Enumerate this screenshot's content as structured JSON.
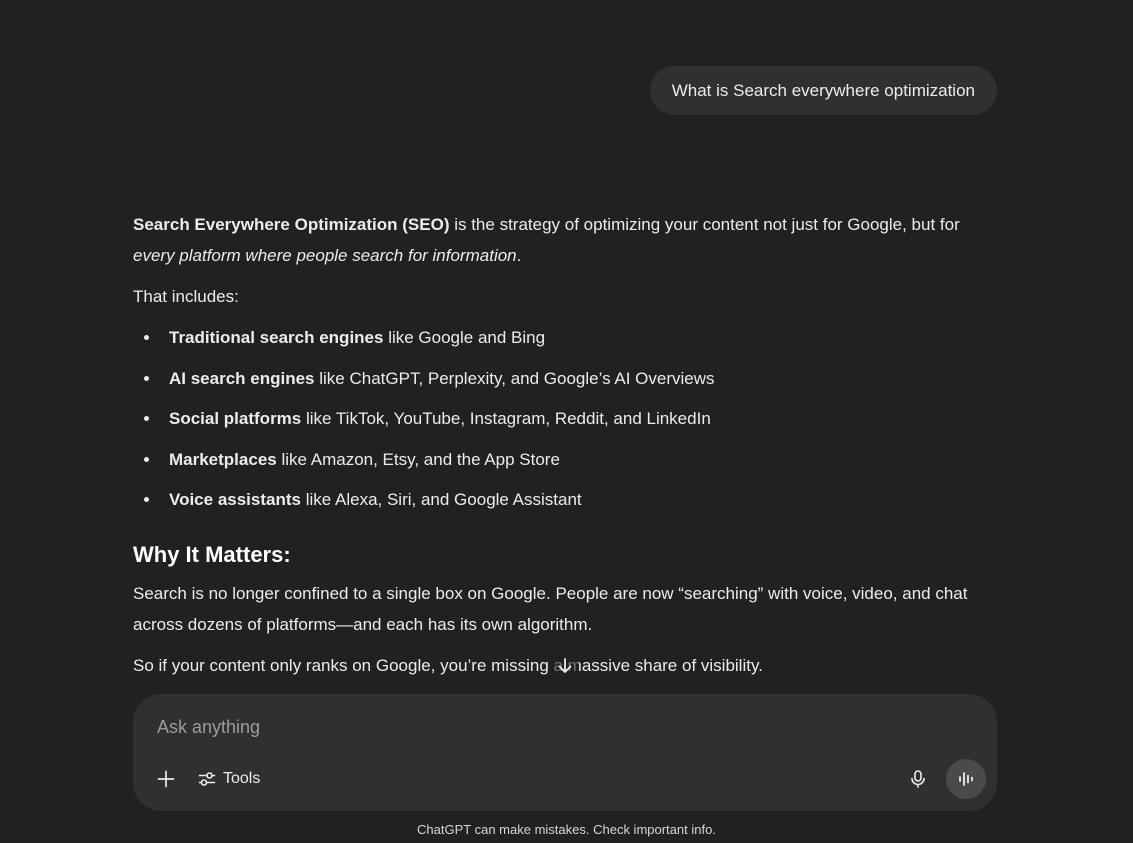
{
  "user_message": "What is Search everywhere optimization",
  "answer": {
    "intro_bold": "Search Everywhere Optimization (SEO)",
    "intro_rest": " is the strategy of optimizing your content not just for Google, but for ",
    "intro_italic": "every platform where people search for information",
    "intro_end": ".",
    "includes": "That includes:",
    "list": [
      {
        "bold": "Traditional search engines",
        "rest": " like Google and Bing"
      },
      {
        "bold": "AI search engines",
        "rest": " like ChatGPT, Perplexity, and Google’s AI Overviews"
      },
      {
        "bold": "Social platforms",
        "rest": " like TikTok, YouTube, Instagram, Reddit, and LinkedIn"
      },
      {
        "bold": "Marketplaces",
        "rest": " like Amazon, Etsy, and the App Store"
      },
      {
        "bold": "Voice assistants",
        "rest": " like Alexa, Siri, and Google Assistant"
      }
    ],
    "heading": "Why It Matters:",
    "para1": "Search is no longer confined to a single box on Google. People are now “searching” with voice, video, and chat across dozens of platforms—and each has its own algorithm.",
    "para2": "So if your content only ranks on Google, you’re missing a massive share of visibility."
  },
  "composer": {
    "placeholder": "Ask anything",
    "tools_label": "Tools"
  },
  "disclaimer": "ChatGPT can make mistakes. Check important info.",
  "icons": {
    "scroll": "arrow-down-icon",
    "plus": "plus-icon",
    "tools": "sliders-icon",
    "mic": "microphone-icon",
    "voice": "voice-waveform-icon"
  }
}
